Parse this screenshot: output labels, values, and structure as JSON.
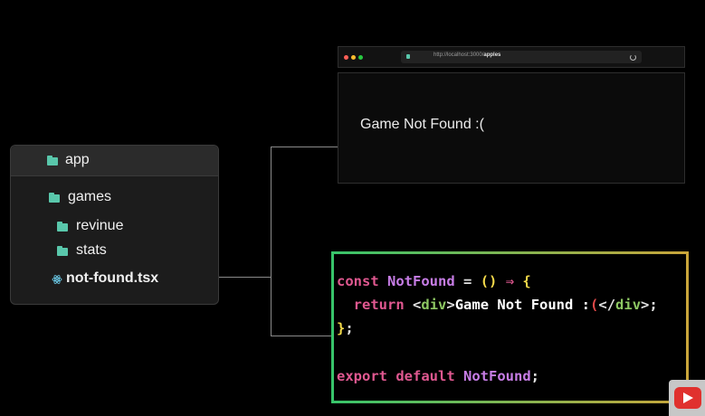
{
  "file_tree": {
    "items": [
      {
        "label": "app",
        "icon": "folder-icon"
      },
      {
        "label": "games",
        "icon": "folder-icon"
      },
      {
        "label": "revinue",
        "icon": "folder-icon"
      },
      {
        "label": "stats",
        "icon": "folder-icon"
      },
      {
        "label": "not-found.tsx",
        "icon": "react-icon"
      }
    ]
  },
  "browser": {
    "url_prefix": "http://localhost:3000/",
    "url_path": "apples",
    "page_text": "Game Not Found :("
  },
  "code": {
    "line1": {
      "kw": "const",
      "name": "NotFound",
      "eq": "=",
      "parens": "()",
      "arrow": "⇒",
      "brace": "{"
    },
    "line2": {
      "kw": "return",
      "lt": "<",
      "tag": "div",
      "gt": ">",
      "text": "Game Not Found :",
      "err": "(",
      "close_lt": "</",
      "close_tag": "div",
      "close_gt": ">;"
    },
    "line3": {
      "brace": "}",
      "semi": ";"
    },
    "line5": {
      "kw1": "export",
      "kw2": "default",
      "name": "NotFound",
      "semi": ";"
    }
  },
  "colors": {
    "folder": "#59c7ab",
    "keyword": "#e05890",
    "identifier": "#c77de6",
    "tag": "#8ec863",
    "paren": "#f3d94a",
    "code_border_start": "#38c46a",
    "code_border_end": "#c9a53a"
  }
}
